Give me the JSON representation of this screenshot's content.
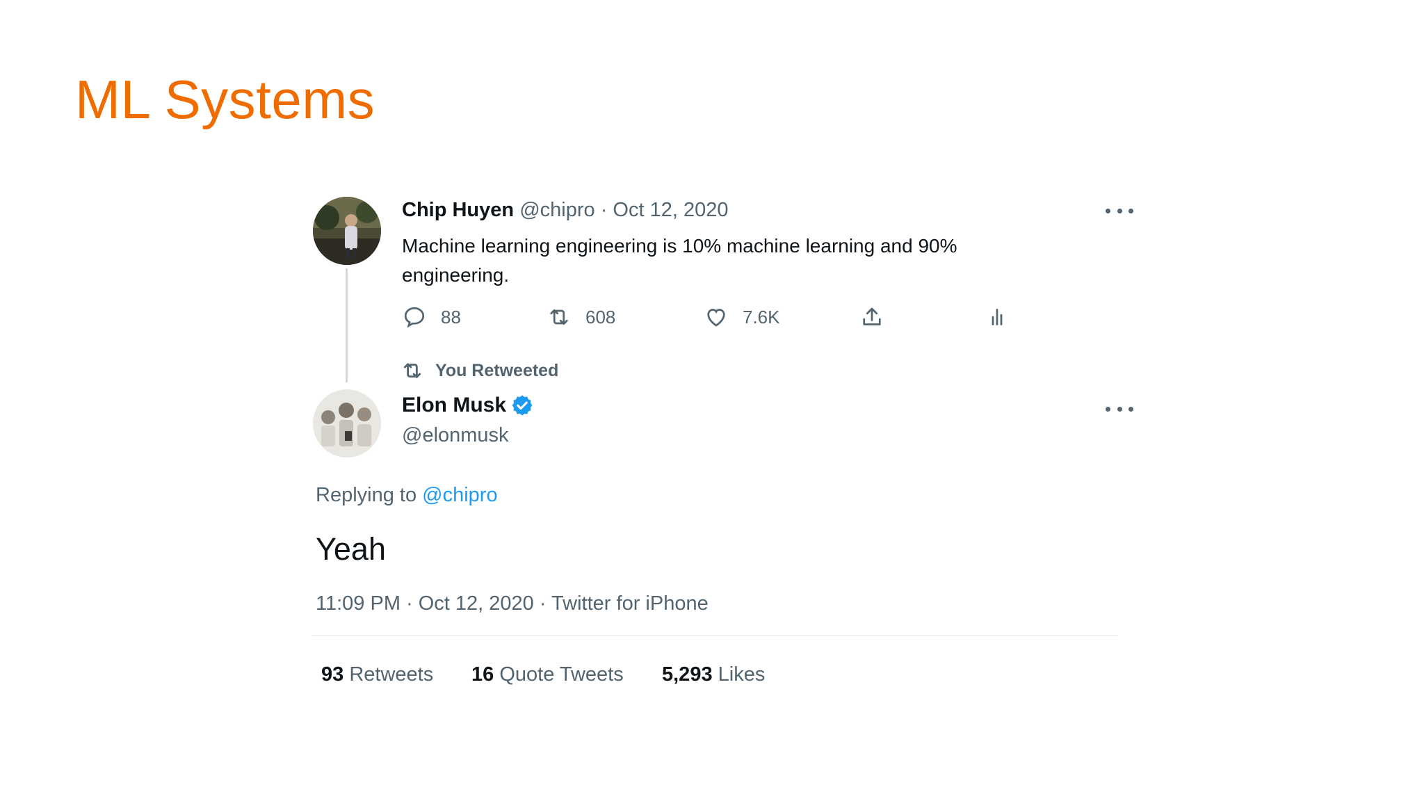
{
  "slide": {
    "title": "ML Systems",
    "title_color": "#ef6c00"
  },
  "original_tweet": {
    "author_name": "Chip Huyen",
    "author_handle": "@chipro",
    "separator": "·",
    "date": "Oct 12, 2020",
    "text_line1": "Machine learning engineering is 10% machine learning and 90%",
    "text_line2": "engineering.",
    "actions": {
      "reply_count": "88",
      "retweet_count": "608",
      "like_count": "7.6K"
    }
  },
  "retweet_context": {
    "label": "You Retweeted"
  },
  "reply_tweet": {
    "author_name": "Elon Musk",
    "verified": true,
    "author_handle": "@elonmusk",
    "replying_prefix": "Replying to",
    "replying_to": "@chipro",
    "text": "Yeah",
    "meta": "11:09 PM · Oct 12, 2020 · Twitter for iPhone",
    "stats": {
      "retweets_value": "93",
      "retweets_label": "Retweets",
      "quotes_value": "16",
      "quotes_label": "Quote Tweets",
      "likes_value": "5,293",
      "likes_label": "Likes"
    }
  },
  "colors": {
    "accent": "#1d9bf0",
    "text": "#0f1419",
    "muted": "#536471",
    "verified": "#1d9bf0"
  },
  "icons": [
    "reply-icon",
    "retweet-icon",
    "like-icon",
    "share-icon",
    "analytics-icon",
    "more-icon",
    "verified-badge-icon"
  ]
}
